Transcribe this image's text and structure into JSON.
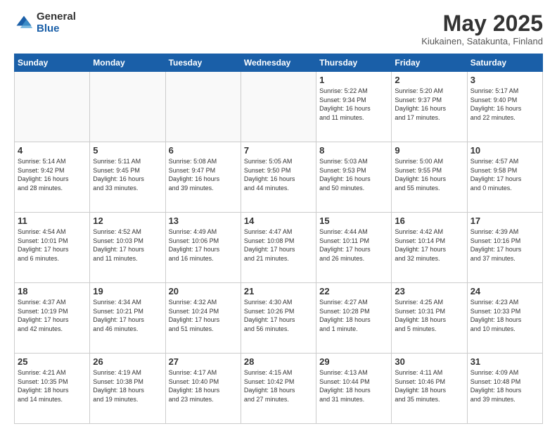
{
  "logo": {
    "general": "General",
    "blue": "Blue"
  },
  "header": {
    "month": "May 2025",
    "location": "Kiukainen, Satakunta, Finland"
  },
  "weekdays": [
    "Sunday",
    "Monday",
    "Tuesday",
    "Wednesday",
    "Thursday",
    "Friday",
    "Saturday"
  ],
  "weeks": [
    [
      {
        "day": "",
        "info": ""
      },
      {
        "day": "",
        "info": ""
      },
      {
        "day": "",
        "info": ""
      },
      {
        "day": "",
        "info": ""
      },
      {
        "day": "1",
        "info": "Sunrise: 5:22 AM\nSunset: 9:34 PM\nDaylight: 16 hours\nand 11 minutes."
      },
      {
        "day": "2",
        "info": "Sunrise: 5:20 AM\nSunset: 9:37 PM\nDaylight: 16 hours\nand 17 minutes."
      },
      {
        "day": "3",
        "info": "Sunrise: 5:17 AM\nSunset: 9:40 PM\nDaylight: 16 hours\nand 22 minutes."
      }
    ],
    [
      {
        "day": "4",
        "info": "Sunrise: 5:14 AM\nSunset: 9:42 PM\nDaylight: 16 hours\nand 28 minutes."
      },
      {
        "day": "5",
        "info": "Sunrise: 5:11 AM\nSunset: 9:45 PM\nDaylight: 16 hours\nand 33 minutes."
      },
      {
        "day": "6",
        "info": "Sunrise: 5:08 AM\nSunset: 9:47 PM\nDaylight: 16 hours\nand 39 minutes."
      },
      {
        "day": "7",
        "info": "Sunrise: 5:05 AM\nSunset: 9:50 PM\nDaylight: 16 hours\nand 44 minutes."
      },
      {
        "day": "8",
        "info": "Sunrise: 5:03 AM\nSunset: 9:53 PM\nDaylight: 16 hours\nand 50 minutes."
      },
      {
        "day": "9",
        "info": "Sunrise: 5:00 AM\nSunset: 9:55 PM\nDaylight: 16 hours\nand 55 minutes."
      },
      {
        "day": "10",
        "info": "Sunrise: 4:57 AM\nSunset: 9:58 PM\nDaylight: 17 hours\nand 0 minutes."
      }
    ],
    [
      {
        "day": "11",
        "info": "Sunrise: 4:54 AM\nSunset: 10:01 PM\nDaylight: 17 hours\nand 6 minutes."
      },
      {
        "day": "12",
        "info": "Sunrise: 4:52 AM\nSunset: 10:03 PM\nDaylight: 17 hours\nand 11 minutes."
      },
      {
        "day": "13",
        "info": "Sunrise: 4:49 AM\nSunset: 10:06 PM\nDaylight: 17 hours\nand 16 minutes."
      },
      {
        "day": "14",
        "info": "Sunrise: 4:47 AM\nSunset: 10:08 PM\nDaylight: 17 hours\nand 21 minutes."
      },
      {
        "day": "15",
        "info": "Sunrise: 4:44 AM\nSunset: 10:11 PM\nDaylight: 17 hours\nand 26 minutes."
      },
      {
        "day": "16",
        "info": "Sunrise: 4:42 AM\nSunset: 10:14 PM\nDaylight: 17 hours\nand 32 minutes."
      },
      {
        "day": "17",
        "info": "Sunrise: 4:39 AM\nSunset: 10:16 PM\nDaylight: 17 hours\nand 37 minutes."
      }
    ],
    [
      {
        "day": "18",
        "info": "Sunrise: 4:37 AM\nSunset: 10:19 PM\nDaylight: 17 hours\nand 42 minutes."
      },
      {
        "day": "19",
        "info": "Sunrise: 4:34 AM\nSunset: 10:21 PM\nDaylight: 17 hours\nand 46 minutes."
      },
      {
        "day": "20",
        "info": "Sunrise: 4:32 AM\nSunset: 10:24 PM\nDaylight: 17 hours\nand 51 minutes."
      },
      {
        "day": "21",
        "info": "Sunrise: 4:30 AM\nSunset: 10:26 PM\nDaylight: 17 hours\nand 56 minutes."
      },
      {
        "day": "22",
        "info": "Sunrise: 4:27 AM\nSunset: 10:28 PM\nDaylight: 18 hours\nand 1 minute."
      },
      {
        "day": "23",
        "info": "Sunrise: 4:25 AM\nSunset: 10:31 PM\nDaylight: 18 hours\nand 5 minutes."
      },
      {
        "day": "24",
        "info": "Sunrise: 4:23 AM\nSunset: 10:33 PM\nDaylight: 18 hours\nand 10 minutes."
      }
    ],
    [
      {
        "day": "25",
        "info": "Sunrise: 4:21 AM\nSunset: 10:35 PM\nDaylight: 18 hours\nand 14 minutes."
      },
      {
        "day": "26",
        "info": "Sunrise: 4:19 AM\nSunset: 10:38 PM\nDaylight: 18 hours\nand 19 minutes."
      },
      {
        "day": "27",
        "info": "Sunrise: 4:17 AM\nSunset: 10:40 PM\nDaylight: 18 hours\nand 23 minutes."
      },
      {
        "day": "28",
        "info": "Sunrise: 4:15 AM\nSunset: 10:42 PM\nDaylight: 18 hours\nand 27 minutes."
      },
      {
        "day": "29",
        "info": "Sunrise: 4:13 AM\nSunset: 10:44 PM\nDaylight: 18 hours\nand 31 minutes."
      },
      {
        "day": "30",
        "info": "Sunrise: 4:11 AM\nSunset: 10:46 PM\nDaylight: 18 hours\nand 35 minutes."
      },
      {
        "day": "31",
        "info": "Sunrise: 4:09 AM\nSunset: 10:48 PM\nDaylight: 18 hours\nand 39 minutes."
      }
    ]
  ]
}
